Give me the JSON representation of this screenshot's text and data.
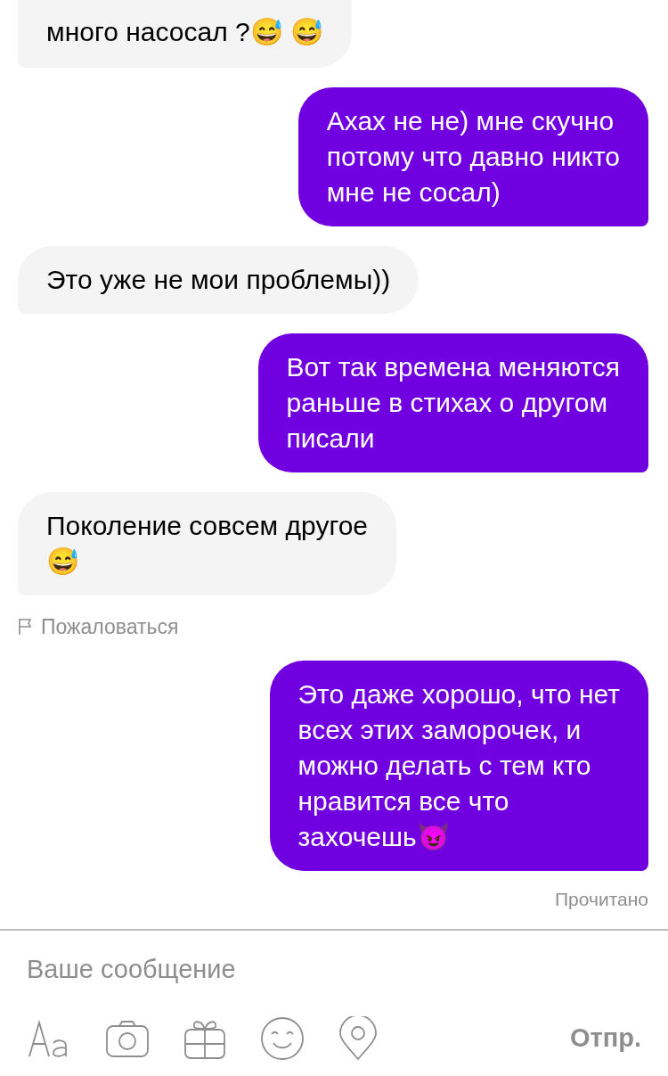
{
  "messages": [
    {
      "kind": "incoming",
      "lines": [
        "много насосал ?😅 😅"
      ],
      "clipped_top": true
    },
    {
      "kind": "outgoing",
      "lines": [
        "Ахах не не) мне скучно",
        "потому что давно никто",
        "мне не сосал)"
      ]
    },
    {
      "kind": "incoming",
      "lines": [
        "Это уже не мои проблемы))"
      ]
    },
    {
      "kind": "outgoing",
      "lines": [
        "Вот так времена меняются",
        "раньше в стихах о другом",
        "писали"
      ]
    },
    {
      "kind": "incoming",
      "lines": [
        "Поколение совсем другое",
        "😅"
      ]
    },
    {
      "kind": "report",
      "text": "Пожаловаться"
    },
    {
      "kind": "outgoing",
      "lines": [
        "Это даже хорошо, что нет",
        "всех этих заморочек, и",
        "можно делать с тем кто",
        "нравится все что",
        "захочешь😈"
      ]
    },
    {
      "kind": "status",
      "text": "Прочитано"
    }
  ],
  "composer": {
    "placeholder": "Ваше сообщение",
    "send": "Отпр."
  }
}
